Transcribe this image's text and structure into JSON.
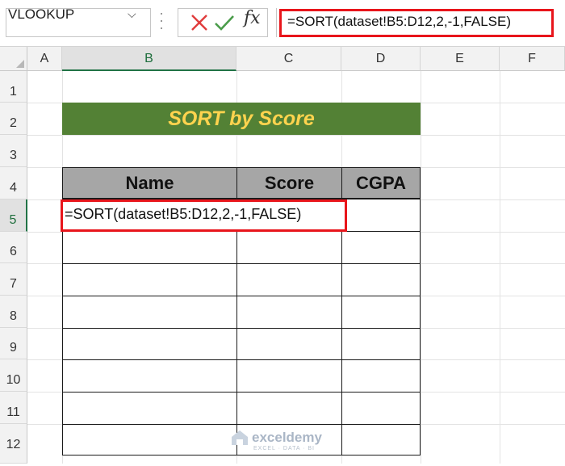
{
  "name_box": {
    "value": "VLOOKUP"
  },
  "formula_bar": {
    "fx_label": "fx",
    "formula": "=SORT(dataset!B5:D12,2,-1,FALSE)"
  },
  "columns": [
    "A",
    "B",
    "C",
    "D",
    "E",
    "F"
  ],
  "rows": [
    "1",
    "2",
    "3",
    "4",
    "5",
    "6",
    "7",
    "8",
    "9",
    "10",
    "11",
    "12"
  ],
  "selected_column": "B",
  "selected_row": "5",
  "title": "SORT by Score",
  "table": {
    "headers": [
      "Name",
      "Score",
      "CGPA"
    ],
    "active_cell_formula": "=SORT(dataset!B5:D12,2,-1,FALSE)"
  },
  "watermark": {
    "name": "exceldemy",
    "tagline": "EXCEL · DATA · BI"
  },
  "colors": {
    "title_fill": "#538135",
    "title_text": "#ffd34e",
    "header_fill": "#a6a6a6",
    "highlight": "#e8151b",
    "selection": "#217346"
  }
}
